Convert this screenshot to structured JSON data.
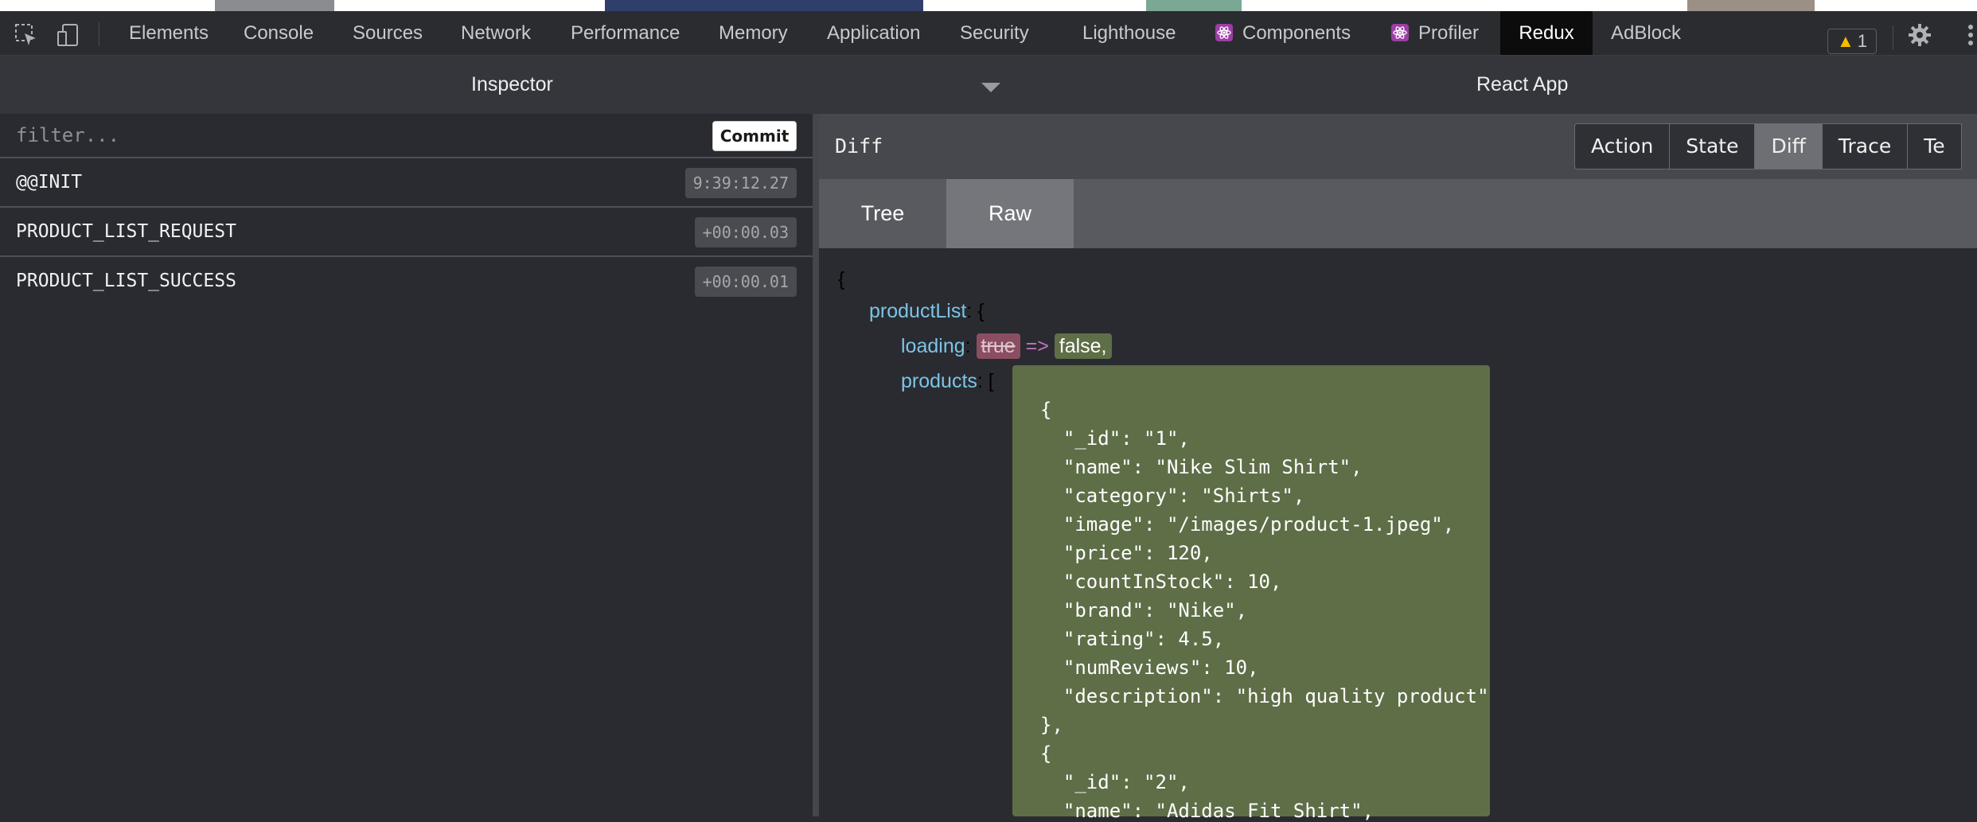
{
  "tabbar": {
    "tabs": [
      "Elements",
      "Console",
      "Sources",
      "Network",
      "Performance",
      "Memory",
      "Application",
      "Security",
      "Lighthouse",
      "Components",
      "Profiler",
      "Redux",
      "AdBlock"
    ],
    "active_tab": "Redux",
    "warning_count": "1"
  },
  "panel_header": {
    "left_title": "Inspector",
    "right_title": "React App"
  },
  "left": {
    "filter_placeholder": "filter...",
    "commit_label": "Commit",
    "actions": [
      {
        "name": "@@INIT",
        "time": "9:39:12.27"
      },
      {
        "name": "PRODUCT_LIST_REQUEST",
        "time": "+00:00.03"
      },
      {
        "name": "PRODUCT_LIST_SUCCESS",
        "time": "+00:00.01"
      }
    ]
  },
  "right": {
    "title": "Diff",
    "view_buttons": [
      "Action",
      "State",
      "Diff",
      "Trace",
      "Te"
    ],
    "active_view": "Diff",
    "subtabs": [
      "Tree",
      "Raw"
    ],
    "active_subtab": "Raw",
    "diff": {
      "open_brace": "{",
      "product_list_key": "productList",
      "product_list_open": ": {",
      "loading_key": "loading",
      "loading_old": "true",
      "arrow": "=>",
      "loading_new": "false,",
      "products_key": "products",
      "products_open": "[",
      "products_lines": [
        "{",
        "  \"_id\": \"1\",",
        "  \"name\": \"Nike Slim Shirt\",",
        "  \"category\": \"Shirts\",",
        "  \"image\": \"/images/product-1.jpeg\",",
        "  \"price\": 120,",
        "  \"countInStock\": 10,",
        "  \"brand\": \"Nike\",",
        "  \"rating\": 4.5,",
        "  \"numReviews\": 10,",
        "  \"description\": \"high quality product\"",
        "},",
        "{",
        "  \"_id\": \"2\",",
        "  \"name\": \"Adidas Fit Shirt\","
      ]
    }
  },
  "colors": {
    "active_tab_bg": "#0c0c0d",
    "diff_removed_bg": "#8a4d61",
    "diff_added_bg": "#5e6e47",
    "key_color": "#7cc4e6",
    "arrow_color": "#c271c2"
  }
}
